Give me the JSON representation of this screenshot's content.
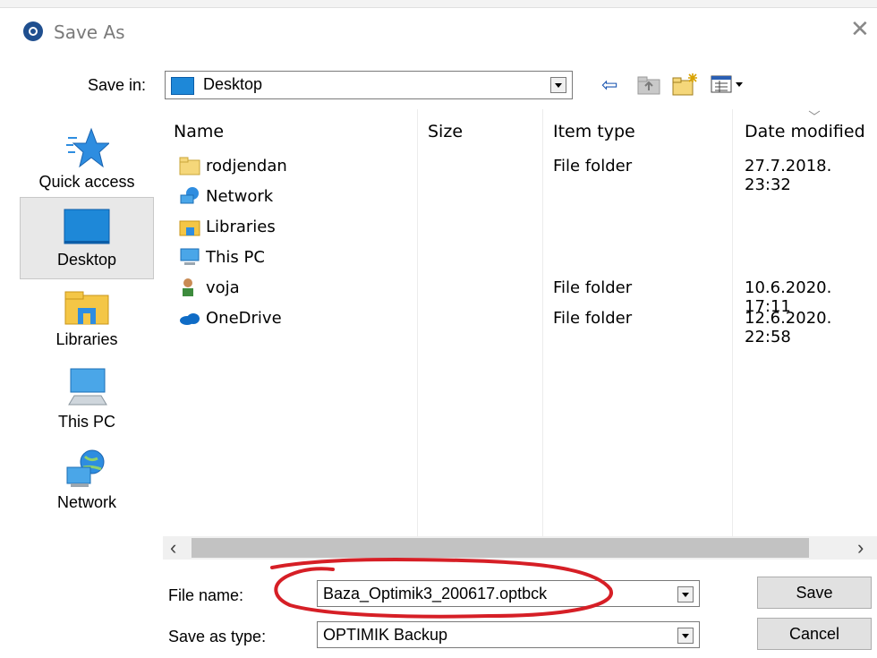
{
  "window": {
    "title": "Save As",
    "close_glyph": "✕",
    "app_icon": "app-icon"
  },
  "save_in": {
    "label": "Save in:",
    "value": "Desktop"
  },
  "toolbar": {
    "back_icon": "⇦",
    "up_icon": "up-folder-icon",
    "new_folder_icon": "new-folder-icon",
    "view_menu_icon": "view-menu-icon"
  },
  "places": [
    {
      "label": "Quick access",
      "icon": "star-icon",
      "selected": false
    },
    {
      "label": "Desktop",
      "icon": "desktop-icon",
      "selected": true
    },
    {
      "label": "Libraries",
      "icon": "libraries-icon",
      "selected": false
    },
    {
      "label": "This PC",
      "icon": "computer-icon",
      "selected": false
    },
    {
      "label": "Network",
      "icon": "network-icon",
      "selected": false
    }
  ],
  "columns": {
    "name": "Name",
    "size": "Size",
    "type": "Item type",
    "date": "Date modified"
  },
  "files": [
    {
      "name": "rodjendan",
      "size": "",
      "type": "File folder",
      "date": "27.7.2018. 23:32",
      "icon": "folder-icon"
    },
    {
      "name": "Network",
      "size": "",
      "type": "",
      "date": "",
      "icon": "network-icon"
    },
    {
      "name": "Libraries",
      "size": "",
      "type": "",
      "date": "",
      "icon": "libraries-icon"
    },
    {
      "name": "This PC",
      "size": "",
      "type": "",
      "date": "",
      "icon": "computer-icon"
    },
    {
      "name": "voja",
      "size": "",
      "type": "File folder",
      "date": "10.6.2020. 17:11",
      "icon": "user-icon"
    },
    {
      "name": "OneDrive",
      "size": "",
      "type": "File folder",
      "date": "12.6.2020. 22:58",
      "icon": "onedrive-icon"
    }
  ],
  "scroll": {
    "left_arrow": "‹",
    "right_arrow": "›"
  },
  "file_name": {
    "label": "File name:",
    "value": "Baza_Optimik3_200617.optbck"
  },
  "save_as_type": {
    "label": "Save as type:",
    "value": "OPTIMIK Backup"
  },
  "buttons": {
    "save": "Save",
    "cancel": "Cancel"
  },
  "annotation": {
    "color": "#d61f26"
  }
}
